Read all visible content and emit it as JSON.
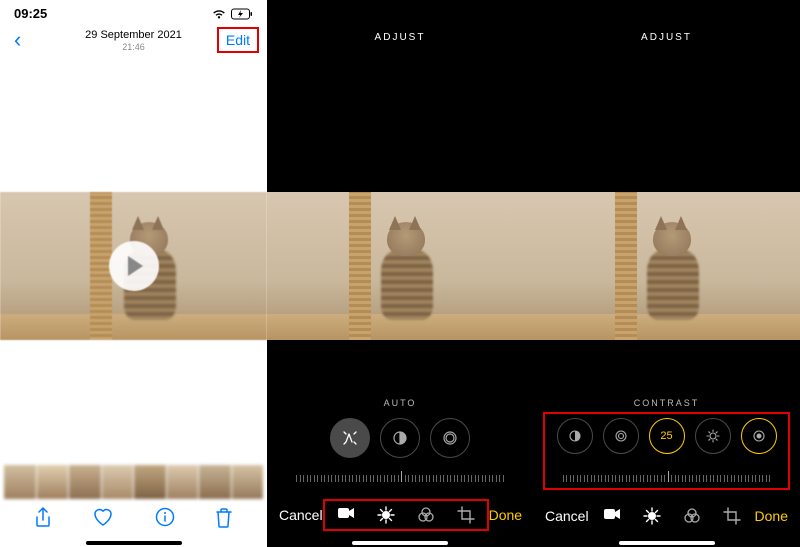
{
  "screen1": {
    "status": {
      "time": "09:25"
    },
    "nav": {
      "date": "29 September 2021",
      "time": "21:46",
      "edit": "Edit"
    }
  },
  "screen2": {
    "header": "ADJUST",
    "mode_label": "AUTO",
    "toolbar": {
      "cancel": "Cancel",
      "done": "Done"
    }
  },
  "screen3": {
    "header": "ADJUST",
    "mode_label": "CONTRAST",
    "value": "25",
    "toolbar": {
      "cancel": "Cancel",
      "done": "Done"
    }
  }
}
